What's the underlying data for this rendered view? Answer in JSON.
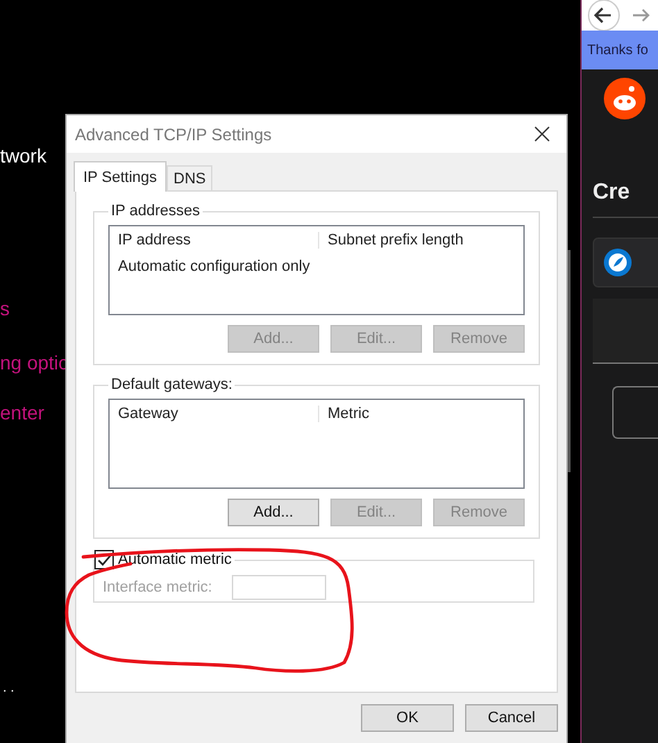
{
  "background_window": {
    "texts": [
      {
        "text": "twork",
        "kind": "heading"
      },
      {
        "text": "s",
        "kind": "link"
      },
      {
        "text": "ng optic",
        "kind": "link"
      },
      {
        "text": "enter",
        "kind": "link"
      },
      {
        "text": ". .",
        "kind": "plain"
      }
    ]
  },
  "browser": {
    "banner": "Thanks fo",
    "heading": "Cre"
  },
  "dialog": {
    "title": "Advanced TCP/IP Settings",
    "tabs": [
      {
        "label": "IP Settings",
        "selected": true
      },
      {
        "label": "DNS",
        "selected": false
      }
    ],
    "groups": [
      {
        "title": "IP addresses",
        "columns": [
          "IP address",
          "Subnet prefix length"
        ],
        "rows": [
          "Automatic configuration only"
        ],
        "buttons": [
          {
            "label": "Add...",
            "disabled": true
          },
          {
            "label": "Edit...",
            "disabled": true
          },
          {
            "label": "Remove",
            "disabled": true
          }
        ]
      },
      {
        "title": "Default gateways:",
        "columns": [
          "Gateway",
          "Metric"
        ],
        "buttons": [
          {
            "label": "Add...",
            "disabled": false
          },
          {
            "label": "Edit...",
            "disabled": true
          },
          {
            "label": "Remove",
            "disabled": true
          }
        ]
      }
    ],
    "automatic_metric": {
      "label": "Automatic metric",
      "checked": true
    },
    "interface_metric": {
      "label": "Interface metric:",
      "disabled": true
    },
    "buttons": [
      "OK",
      "Cancel"
    ]
  }
}
